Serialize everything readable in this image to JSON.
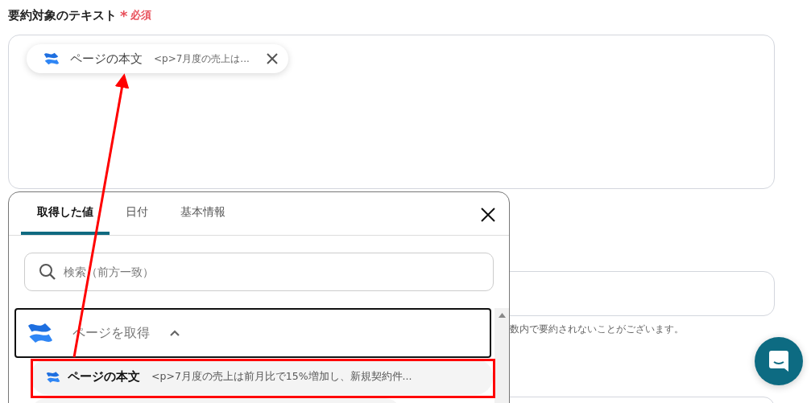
{
  "field": {
    "label": "要約対象のテキスト",
    "required_mark": "*",
    "required_text": "必須",
    "chip": {
      "title": "ページの本文",
      "preview": "<p>7月度の売上は..."
    }
  },
  "helper_text": "数内で要約されないことがございます。",
  "popover": {
    "tabs": [
      {
        "label": "取得した値",
        "selected": true
      },
      {
        "label": "日付",
        "selected": false
      },
      {
        "label": "基本情報",
        "selected": false
      }
    ],
    "search": {
      "placeholder": "検索（前方一致）"
    },
    "group": {
      "title": "ページを取得",
      "expanded": true,
      "items": [
        {
          "title": "ページの本文",
          "preview": "<p>7月度の売上は前月比で15%増加し、新規契約件..."
        }
      ]
    }
  }
}
